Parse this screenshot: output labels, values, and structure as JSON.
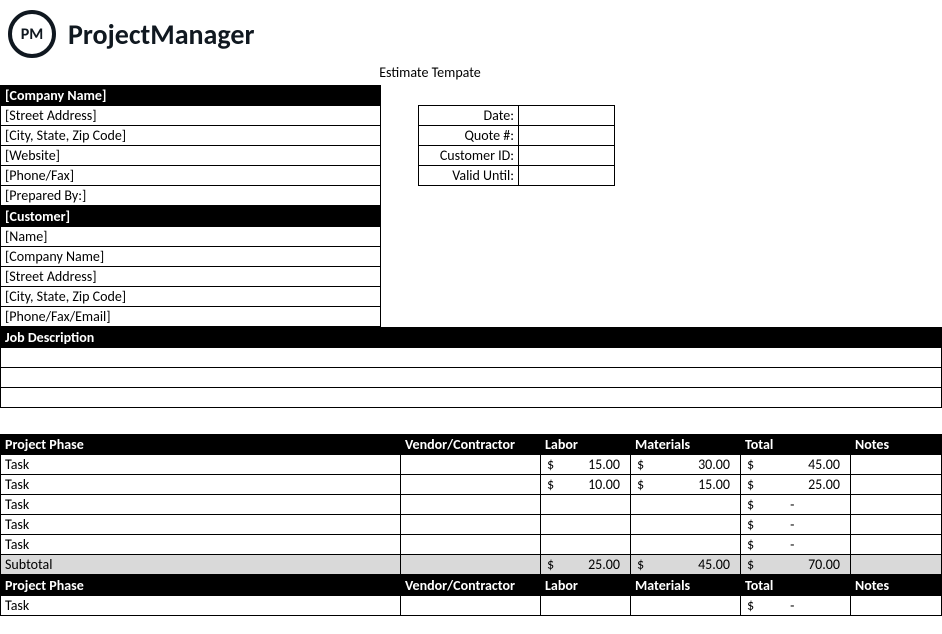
{
  "brand": {
    "logoText": "PM",
    "name": "ProjectManager"
  },
  "title": "Estimate Tempate",
  "company": {
    "header": "[Company Name]",
    "rows": [
      "[Street Address]",
      "[City, State, Zip Code]",
      "[Website]",
      "[Phone/Fax]",
      "[Prepared By:]"
    ]
  },
  "quote": {
    "labels": [
      "Date:",
      "Quote #:",
      "Customer ID:",
      "Valid Until:"
    ],
    "values": [
      "",
      "",
      "",
      ""
    ]
  },
  "customer": {
    "header": "[Customer]",
    "rows": [
      "[Name]",
      "[Company Name]",
      "[Street Address]",
      "[City, State, Zip Code]",
      "[Phone/Fax/Email]"
    ]
  },
  "jobdesc": {
    "header": "Job Description"
  },
  "phase1": {
    "headers": [
      "Project Phase",
      "Vendor/Contractor",
      "Labor",
      "Materials",
      "Total",
      "Notes"
    ],
    "rows": [
      {
        "task": "Task",
        "vendor": "",
        "labor": "15.00",
        "materials": "30.00",
        "total": "45.00",
        "notes": ""
      },
      {
        "task": "Task",
        "vendor": "",
        "labor": "10.00",
        "materials": "15.00",
        "total": "25.00",
        "notes": ""
      },
      {
        "task": "Task",
        "vendor": "",
        "labor": "",
        "materials": "",
        "total": "-",
        "notes": ""
      },
      {
        "task": "Task",
        "vendor": "",
        "labor": "",
        "materials": "",
        "total": "-",
        "notes": ""
      },
      {
        "task": "Task",
        "vendor": "",
        "labor": "",
        "materials": "",
        "total": "-",
        "notes": ""
      }
    ],
    "subtotal": {
      "label": "Subtotal",
      "labor": "25.00",
      "materials": "45.00",
      "total": "70.00"
    }
  },
  "phase2": {
    "headers": [
      "Project Phase",
      "Vendor/Contractor",
      "Labor",
      "Materials",
      "Total",
      "Notes"
    ],
    "rows": [
      {
        "task": "Task",
        "vendor": "",
        "labor": "",
        "materials": "",
        "total": "-",
        "notes": ""
      }
    ]
  },
  "sym": "$"
}
